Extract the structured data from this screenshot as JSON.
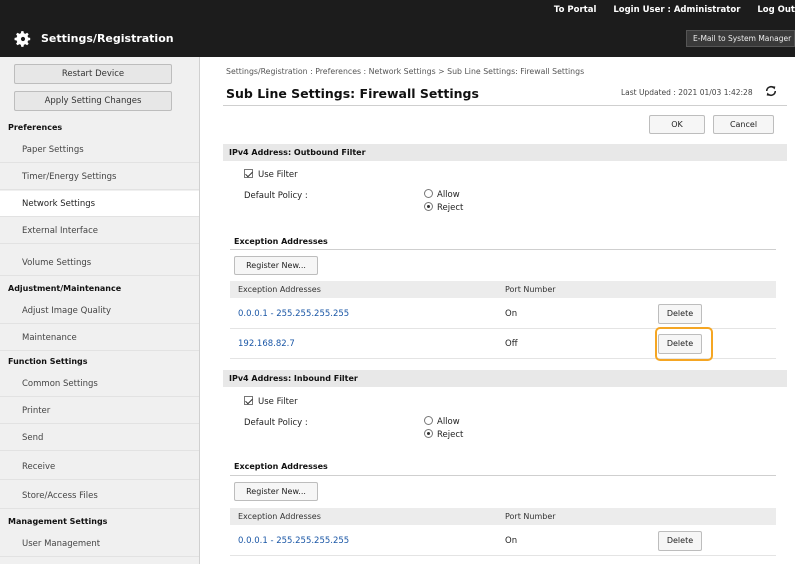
{
  "header": {
    "app_title": "Settings/Registration",
    "links": [
      "To Portal",
      "Login User : Administrator",
      "Log Out"
    ],
    "mail_button": "E-Mail to System Manager"
  },
  "sidebar": {
    "restart_button": "Restart Device",
    "apply_button": "Apply Setting Changes",
    "groups": [
      {
        "heading": "Preferences",
        "items": [
          "Paper Settings",
          "Timer/Energy Settings",
          "Network Settings",
          "External Interface",
          "Volume Settings"
        ]
      },
      {
        "heading": "Adjustment/Maintenance",
        "items": [
          "Adjust Image Quality",
          "Maintenance"
        ]
      },
      {
        "heading": "Function Settings",
        "items": [
          "Common Settings",
          "Printer",
          "Send",
          "Receive",
          "Store/Access Files"
        ]
      },
      {
        "heading": "Management Settings",
        "items": [
          "User Management"
        ]
      }
    ],
    "active_item": "Network Settings"
  },
  "main": {
    "breadcrumb": "Settings/Registration : Preferences : Network Settings > Sub Line Settings: Firewall Settings",
    "title": "Sub Line Settings: Firewall Settings",
    "last_updated": "Last Updated : 2021 01/03 1:42:28",
    "ok_label": "OK",
    "cancel_label": "Cancel",
    "outbound": {
      "heading": "IPv4 Address: Outbound Filter",
      "use_filter": "Use Filter",
      "policy_label": "Default Policy :",
      "allow": "Allow",
      "reject": "Reject",
      "exception_heading": "Exception Addresses",
      "register_label": "Register New...",
      "col_address": "Exception Addresses",
      "col_port": "Port Number",
      "rows": [
        {
          "address": "0.0.0.1 - 255.255.255.255",
          "port": "On",
          "delete": "Delete"
        },
        {
          "address": "192.168.82.7",
          "port": "Off",
          "delete": "Delete"
        }
      ]
    },
    "inbound": {
      "heading": "IPv4 Address: Inbound Filter",
      "use_filter": "Use Filter",
      "policy_label": "Default Policy :",
      "allow": "Allow",
      "reject": "Reject",
      "exception_heading": "Exception Addresses",
      "register_label": "Register New...",
      "col_address": "Exception Addresses",
      "col_port": "Port Number",
      "rows": [
        {
          "address": "0.0.0.1 - 255.255.255.255",
          "port": "On",
          "delete": "Delete"
        }
      ]
    }
  },
  "colors": {
    "highlight": "#f5a623",
    "link": "#1b57a6",
    "topbar": "#1c1c1c"
  },
  "icons": [
    "gear-icon",
    "refresh-icon"
  ]
}
